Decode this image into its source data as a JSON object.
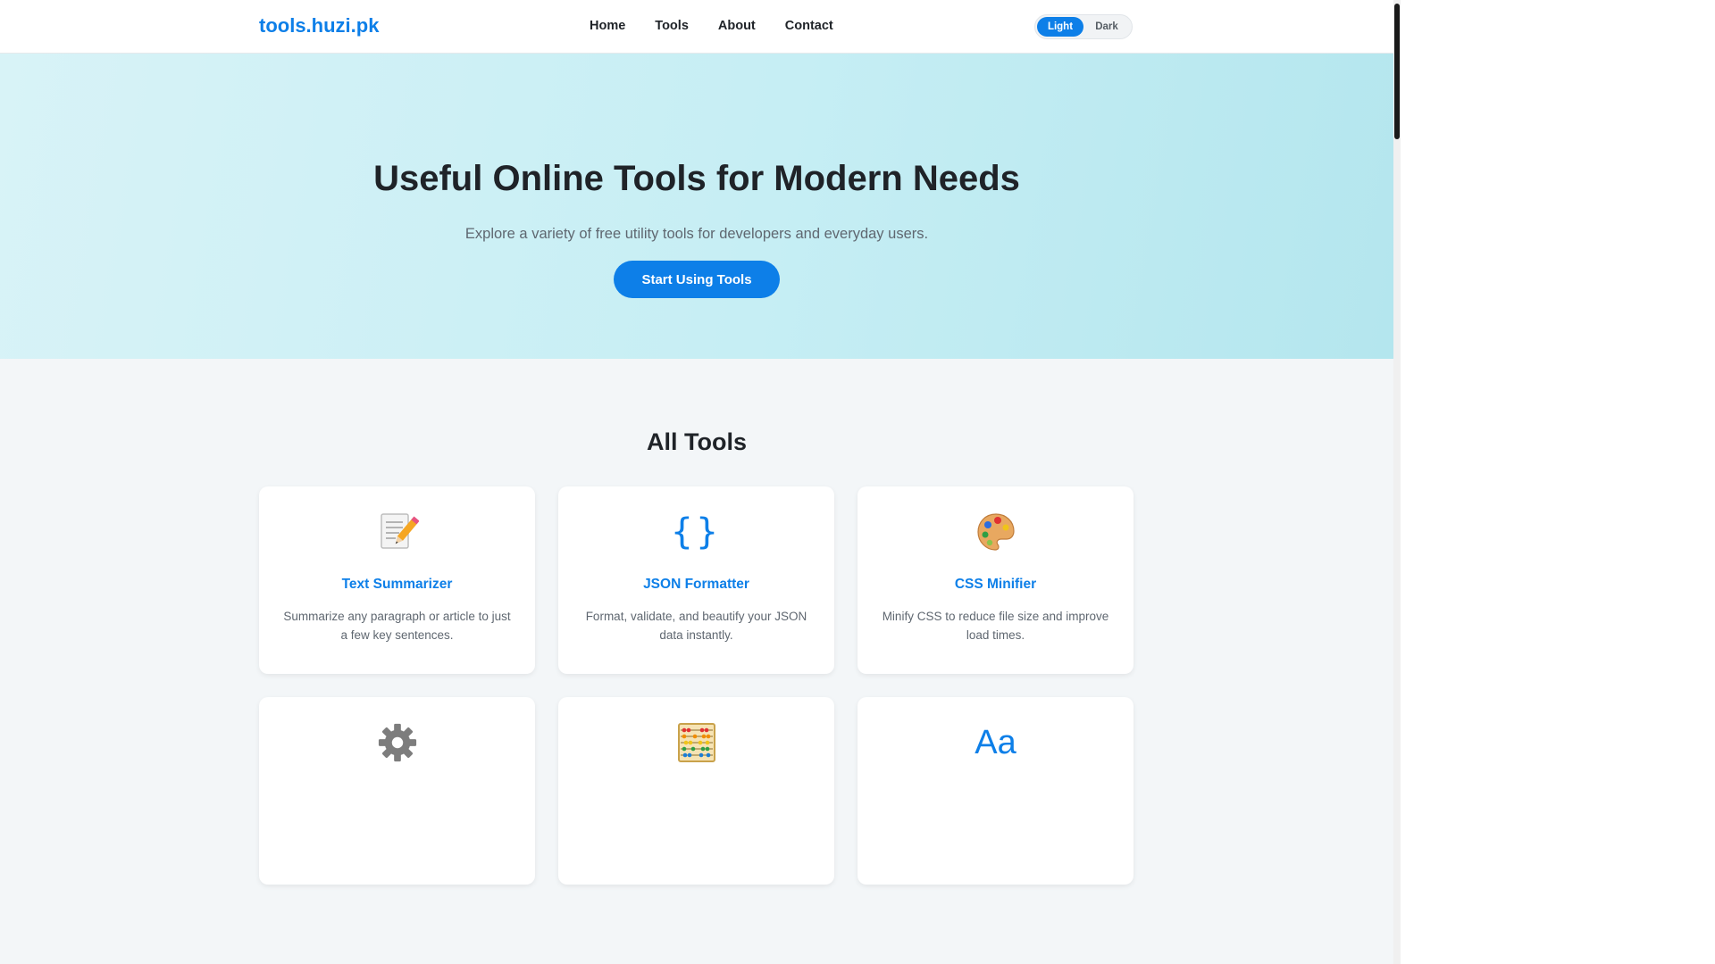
{
  "header": {
    "logo": "tools.huzi.pk",
    "nav": [
      "Home",
      "Tools",
      "About",
      "Contact"
    ],
    "theme": {
      "light": "Light",
      "dark": "Dark",
      "active": "light"
    }
  },
  "hero": {
    "title": "Useful Online Tools for Modern Needs",
    "subtitle": "Explore a variety of free utility tools for developers and everyday users.",
    "cta": "Start Using Tools"
  },
  "tools": {
    "heading": "All Tools",
    "cards": [
      {
        "icon": "memo-pencil-icon",
        "title": "Text Summarizer",
        "desc": "Summarize any paragraph or article to just a few key sentences."
      },
      {
        "icon": "curly-braces-icon",
        "title": "JSON Formatter",
        "desc": "Format, validate, and beautify your JSON data instantly."
      },
      {
        "icon": "paint-palette-icon",
        "title": "CSS Minifier",
        "desc": "Minify CSS to reduce file size and improve load times."
      },
      {
        "icon": "gear-icon",
        "title": "",
        "desc": ""
      },
      {
        "icon": "abacus-icon",
        "title": "",
        "desc": ""
      },
      {
        "icon": "text-aa-icon",
        "glyph": "Aa",
        "title": "",
        "desc": ""
      }
    ]
  },
  "colors": {
    "accent": "#0d7fe8",
    "hero_start": "#d8f3f7",
    "hero_end": "#b4e6ee",
    "section_bg": "#f3f6f8"
  }
}
